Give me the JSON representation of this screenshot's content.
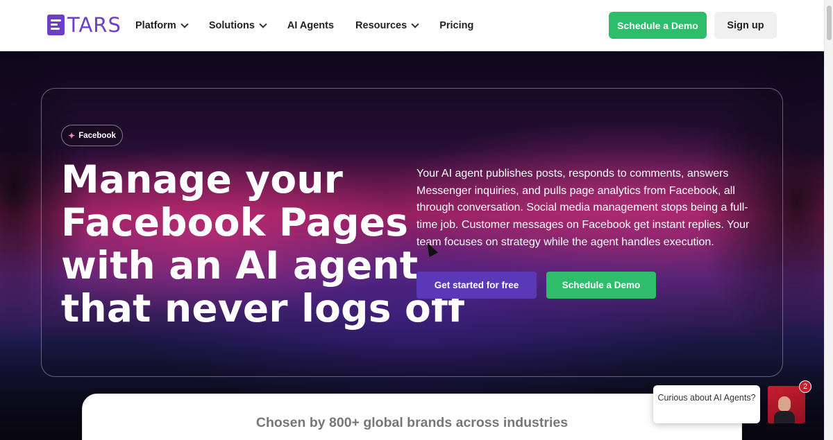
{
  "header": {
    "logo_text": "TARS",
    "nav": [
      {
        "label": "Platform",
        "has_dropdown": true
      },
      {
        "label": "Solutions",
        "has_dropdown": true
      },
      {
        "label": "AI Agents",
        "has_dropdown": false
      },
      {
        "label": "Resources",
        "has_dropdown": true
      },
      {
        "label": "Pricing",
        "has_dropdown": false
      }
    ],
    "demo_button": "Schedule a Demo",
    "signup_button": "Sign up"
  },
  "hero": {
    "badge": "Facebook",
    "title_lines": [
      "Manage your",
      "Facebook Pages",
      "with an AI agent",
      "that never logs off"
    ],
    "description": "Your AI agent publishes posts, responds to comments, answers Messenger inquiries, and pulls page analytics from Facebook, all through conversation. Social media management stops being a full-time job. Customer messages on Facebook get instant replies. Your team focuses on strategy while the agent handles execution.",
    "primary_button": "Get started for free",
    "secondary_button": "Schedule a Demo"
  },
  "brands": {
    "title": "Chosen by 800+ global brands across industries"
  },
  "chat_widget": {
    "message": "Curious about AI Agents?",
    "notification_count": "2"
  },
  "colors": {
    "brand_purple": "#6d3fc9",
    "cta_green": "#2ebd6b",
    "primary_button": "#5b38b8"
  }
}
